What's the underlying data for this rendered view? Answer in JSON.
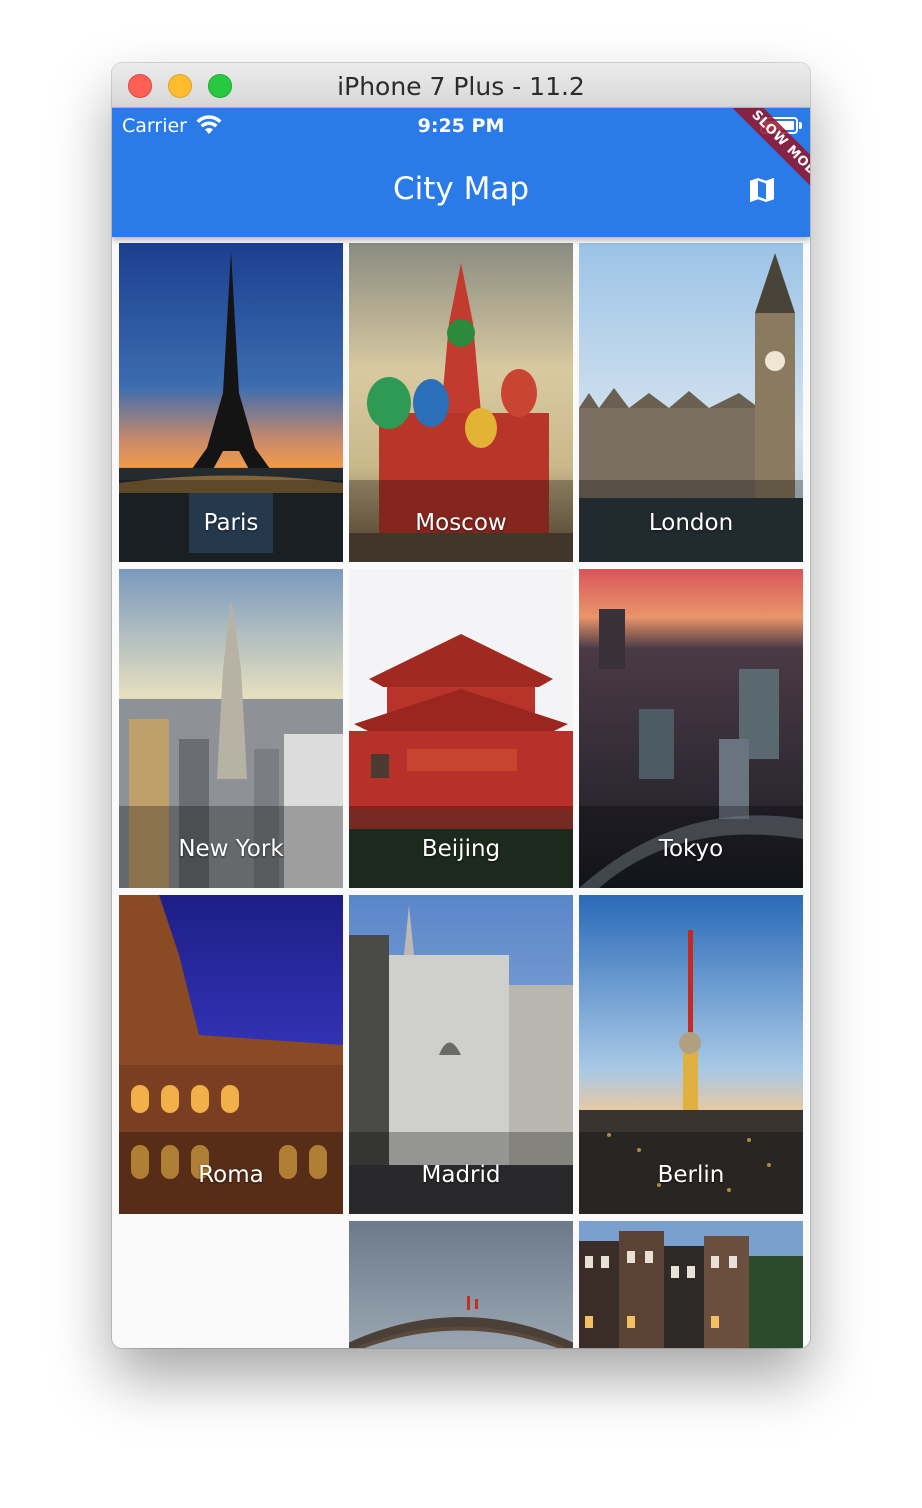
{
  "window": {
    "title": "iPhone 7 Plus - 11.2"
  },
  "status_bar": {
    "carrier": "Carrier",
    "time": "9:25 PM"
  },
  "app_bar": {
    "title": "City Map",
    "action_icon": "map-icon",
    "color": "#2a7be8"
  },
  "debug_banner": {
    "text": "SLOW MODE",
    "color": "#961428"
  },
  "cities": [
    {
      "name": "Paris"
    },
    {
      "name": "Moscow"
    },
    {
      "name": "London"
    },
    {
      "name": "New York"
    },
    {
      "name": "Beijing"
    },
    {
      "name": "Tokyo"
    },
    {
      "name": "Roma"
    },
    {
      "name": "Madrid"
    },
    {
      "name": "Berlin"
    }
  ]
}
